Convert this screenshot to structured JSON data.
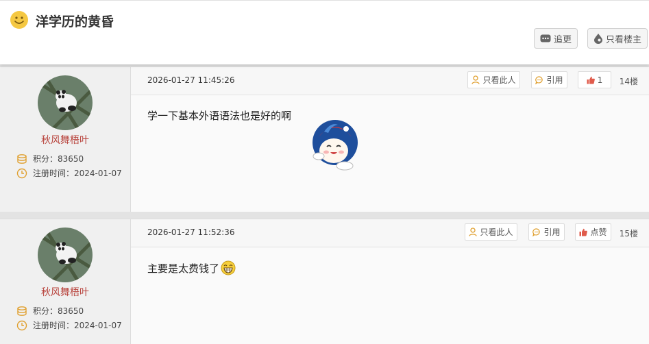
{
  "thread": {
    "title": "洋学历的黄昏",
    "follow_label": "追更",
    "owner_only_label": "只看楼主"
  },
  "posts": [
    {
      "user": {
        "name": "秋风舞梧叶",
        "points": "积分：83650",
        "register": "注册时间：2024-01-07"
      },
      "timestamp": "2026-01-27 11:45:26",
      "only_this_label": "只看此人",
      "quote_label": "引用",
      "like_label": "1",
      "floor": "14楼",
      "content": "学一下基本外语语法也是好的啊"
    },
    {
      "user": {
        "name": "秋风舞梧叶",
        "points": "积分：83650",
        "register": "注册时间：2024-01-07"
      },
      "timestamp": "2026-01-27 11:52:36",
      "only_this_label": "只看此人",
      "quote_label": "引用",
      "like_label": "点赞",
      "floor": "15楼",
      "content": "主要是太费钱了"
    }
  ],
  "colors": {
    "username": "#b8433c",
    "like_icon": "#e05b4b",
    "person_icon": "#e0a030"
  }
}
